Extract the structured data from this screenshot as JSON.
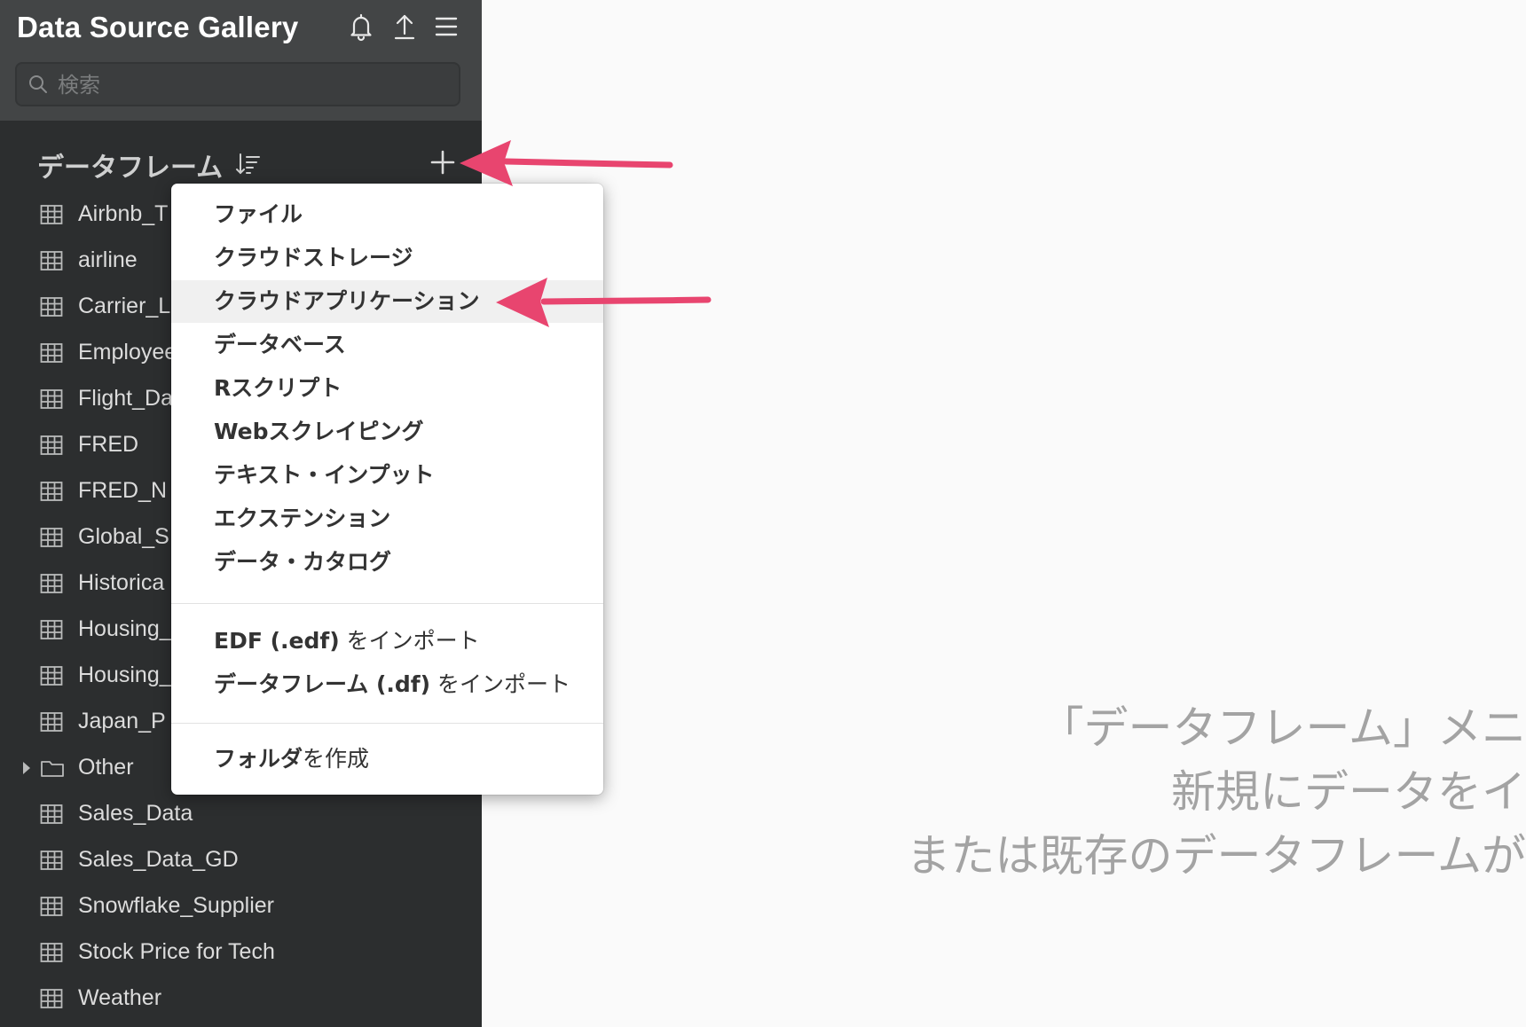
{
  "app": {
    "title": "Data Source Gallery"
  },
  "search": {
    "placeholder": "検索",
    "value": ""
  },
  "section": {
    "title": "データフレーム"
  },
  "dataframes": [
    {
      "label": "Airbnb_T",
      "type": "table"
    },
    {
      "label": "airline",
      "type": "table"
    },
    {
      "label": "Carrier_L",
      "type": "table"
    },
    {
      "label": "Employee",
      "type": "table"
    },
    {
      "label": "Flight_Da",
      "type": "table"
    },
    {
      "label": "FRED",
      "type": "table"
    },
    {
      "label": "FRED_N",
      "type": "table"
    },
    {
      "label": "Global_S",
      "type": "table"
    },
    {
      "label": "Historica",
      "type": "table"
    },
    {
      "label": "Housing_",
      "type": "table"
    },
    {
      "label": "Housing_",
      "type": "table"
    },
    {
      "label": "Japan_P",
      "type": "table"
    },
    {
      "label": "Other",
      "type": "folder"
    },
    {
      "label": "Sales_Data",
      "type": "table"
    },
    {
      "label": "Sales_Data_GD",
      "type": "table"
    },
    {
      "label": "Snowflake_Supplier",
      "type": "table"
    },
    {
      "label": "Stock Price for Tech",
      "type": "table"
    },
    {
      "label": "Weather",
      "type": "table"
    }
  ],
  "menu": {
    "group1": [
      "ファイル",
      "クラウドストレージ",
      "クラウドアプリケーション",
      "データベース",
      "Rスクリプト",
      "Webスクレイピング",
      "テキスト・インプット",
      "エクステンション",
      "データ・カタログ"
    ],
    "import_edf": {
      "bold": "EDF (.edf)",
      "rest": " をインポート"
    },
    "import_df": {
      "bold": "データフレーム (.df)",
      "rest": " をインポート"
    },
    "create_folder": {
      "bold": "フォルダ",
      "rest": "を作成"
    },
    "highlighted_index": 2
  },
  "empty_state": {
    "line1": "「データフレーム」メニ",
    "line2": "新規にデータをイ",
    "line3": "または既存のデータフレームが"
  },
  "colors": {
    "sidebar_bg": "#2c2e2f",
    "header_bg": "#434546",
    "arrow": "#e8456f",
    "main_bg": "#fafafa"
  },
  "icons": {
    "bell": "bell-icon",
    "upload": "upload-icon",
    "menu": "hamburger-menu-icon",
    "search": "search-icon",
    "sort": "sort-icon",
    "add": "plus-icon",
    "table": "table-grid-icon",
    "folder": "folder-icon"
  }
}
